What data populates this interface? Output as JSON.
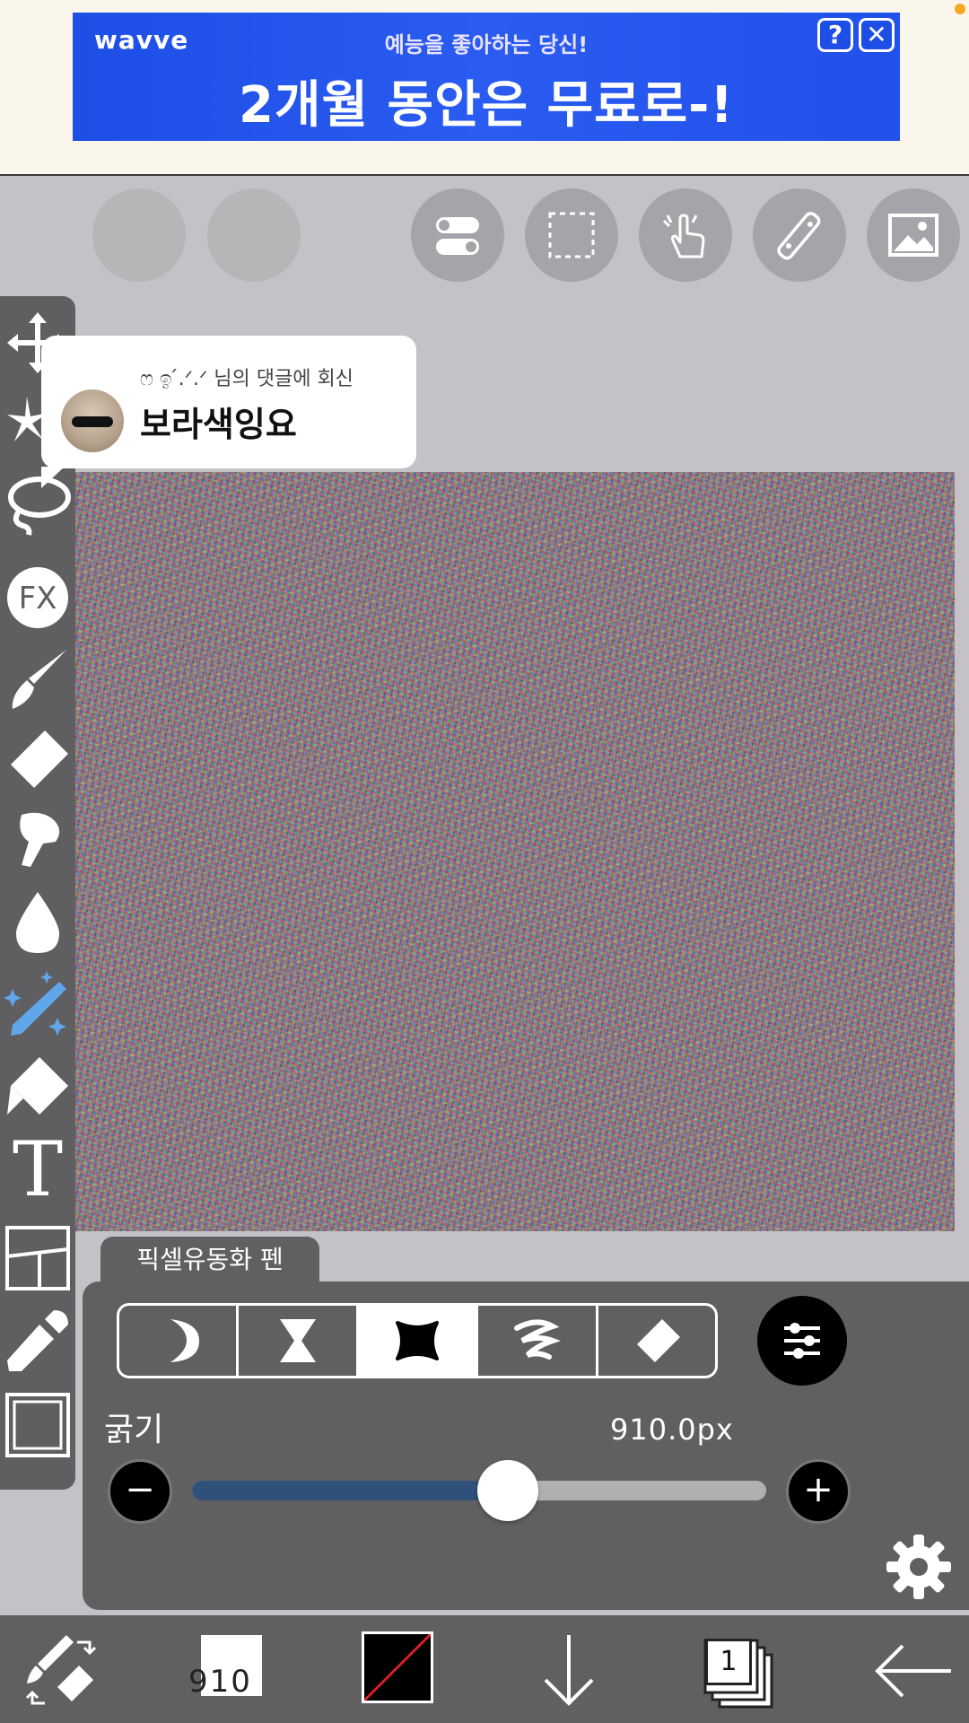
{
  "ad": {
    "brand": "wavve",
    "subtitle": "예능을 좋아하는 당신!",
    "headline": "2개월 동안은 무료로-!",
    "help_icon": "?",
    "close_icon": "✕",
    "colors": {
      "background": "#1d4ee6",
      "text": "#ffffff"
    }
  },
  "top_toolbar": {
    "icons": [
      "undo-icon",
      "redo-icon",
      "toggle-icon",
      "selection-icon",
      "gesture-icon",
      "ruler-icon",
      "image-icon"
    ]
  },
  "tools": [
    "move-icon",
    "magic-wand-icon",
    "lasso-icon",
    "fx-icon",
    "brush-icon",
    "eraser-icon",
    "smudge-icon",
    "blur-drop-icon",
    "sparkle-pen-icon",
    "fill-icon",
    "text-icon",
    "frame-icon",
    "eyedropper-icon",
    "canvas-icon"
  ],
  "tool_labels": {
    "fx": "FX",
    "text": "T"
  },
  "comment": {
    "reply_label": "ෆ ඉ ́.ᐟ.ᐟ 님의 댓글에 회신",
    "text": "보라색잉요"
  },
  "brush": {
    "name": "픽셀유동화 펜",
    "modes": [
      "crescent-icon",
      "hourglass-icon",
      "pinch-icon",
      "swirl-icon",
      "eraser-icon"
    ],
    "active_mode": 2,
    "thickness_label": "굵기",
    "thickness_value": "910.0px",
    "slider_fraction": 0.55,
    "minus": "−",
    "plus": "+"
  },
  "bottom_bar": {
    "brush_size": "910",
    "layer_count": "1",
    "icons": [
      "swap-tools-icon",
      "brush-size-icon",
      "color-icon",
      "down-arrow-icon",
      "layers-icon",
      "back-arrow-icon"
    ],
    "colors": {
      "primary": "#000000",
      "secondary_slash": "#e0202a"
    }
  }
}
